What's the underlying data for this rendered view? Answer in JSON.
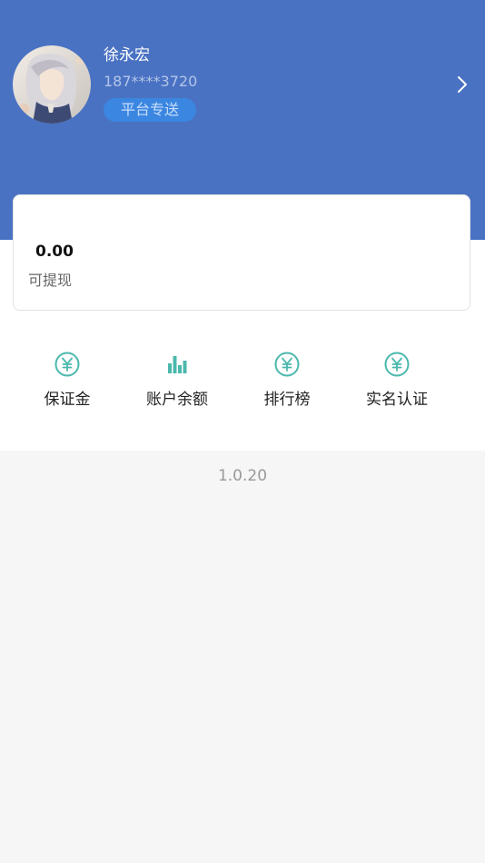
{
  "profile": {
    "name": "徐永宏",
    "phone": "187****3720",
    "badge": "平台专送",
    "arrow_icon": "chevron-right-icon",
    "avatar_desc": "avatar"
  },
  "balance": {
    "amount": "0.00",
    "label": "可提现"
  },
  "menu": {
    "items": [
      {
        "label": "保证金",
        "icon": "yen-circle-icon"
      },
      {
        "label": "账户余额",
        "icon": "bar-chart-icon"
      },
      {
        "label": "排行榜",
        "icon": "yen-circle-icon"
      },
      {
        "label": "实名认证",
        "icon": "yen-circle-icon"
      }
    ]
  },
  "version": "1.0.20",
  "colors": {
    "header_bg": "#4a72c3",
    "badge_bg": "#3b86e0",
    "icon_teal": "#4bb8ad",
    "page_bg": "#f6f6f6"
  }
}
